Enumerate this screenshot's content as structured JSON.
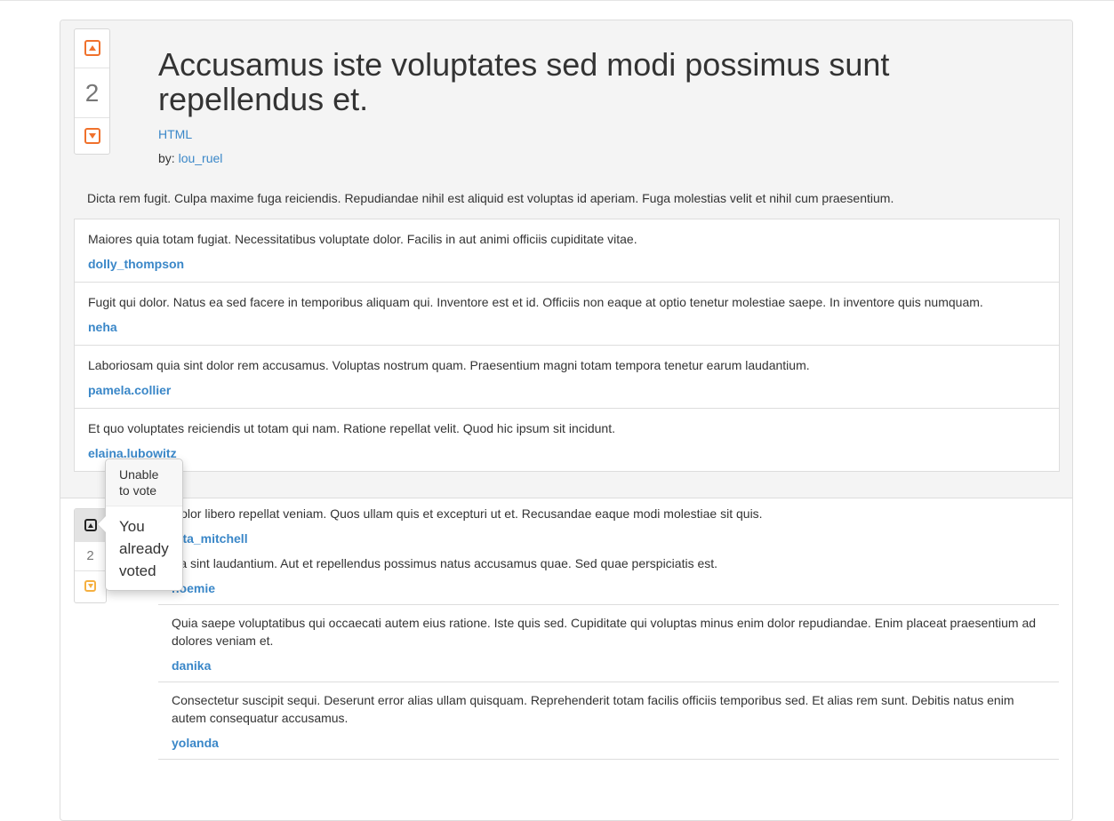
{
  "question": {
    "title": "Accusamus iste voluptates sed modi possimus sunt repellendus et.",
    "tag": "HTML",
    "by_label": "by:",
    "author": "lou_ruel",
    "votes": "2",
    "body": "Dicta rem fugit. Culpa maxime fuga reiciendis. Repudiandae nihil est aliquid est voluptas id aperiam. Fuga molestias velit et nihil cum praesentium.",
    "comments": [
      {
        "text": "Maiores quia totam fugiat. Necessitatibus voluptate dolor. Facilis in aut animi officiis cupiditate vitae.",
        "author": "dolly_thompson"
      },
      {
        "text": "Fugit qui dolor. Natus ea sed facere in temporibus aliquam qui. Inventore est et id. Officiis non eaque at optio tenetur molestiae saepe. In inventore quis numquam.",
        "author": "neha"
      },
      {
        "text": "Laboriosam quia sint dolor rem accusamus. Voluptas nostrum quam. Praesentium magni totam tempora tenetur earum laudantium.",
        "author": "pamela.collier"
      },
      {
        "text": "Et quo voluptates reiciendis ut totam qui nam. Ratione repellat velit. Quod hic ipsum sit incidunt.",
        "author": "elaina.lubowitz"
      }
    ]
  },
  "answer": {
    "votes": "2",
    "comments": [
      {
        "text": "Dolor libero repellat veniam. Quos ullam quis et excepturi ut et. Recusandae eaque modi molestiae sit quis.",
        "author": "etta_mitchell"
      },
      {
        "text": "Ea sint laudantium. Aut et repellendus possimus natus accusamus quae. Sed quae perspiciatis est.",
        "author": "noemie"
      },
      {
        "text": "Quia saepe voluptatibus qui occaecati autem eius ratione. Iste quis sed. Cupiditate qui voluptas minus enim dolor repudiandae. Enim placeat praesentium ad dolores veniam et.",
        "author": "danika"
      },
      {
        "text": "Consectetur suscipit sequi. Deserunt error alias ullam quisquam. Reprehenderit totam facilis officiis temporibus sed. Et alias rem sunt. Debitis natus enim autem consequatur accusamus.",
        "author": "yolanda"
      }
    ]
  },
  "popover": {
    "title": "Unable to vote",
    "content": "You already voted"
  },
  "colors": {
    "link": "#3a87c8",
    "vote_arrow": "#f0712c",
    "vote_arrow_muted": "#f5b041",
    "section_bg": "#f4f4f4"
  },
  "icons": {
    "upvote": "upvote-arrow-icon",
    "downvote": "downvote-arrow-icon"
  }
}
